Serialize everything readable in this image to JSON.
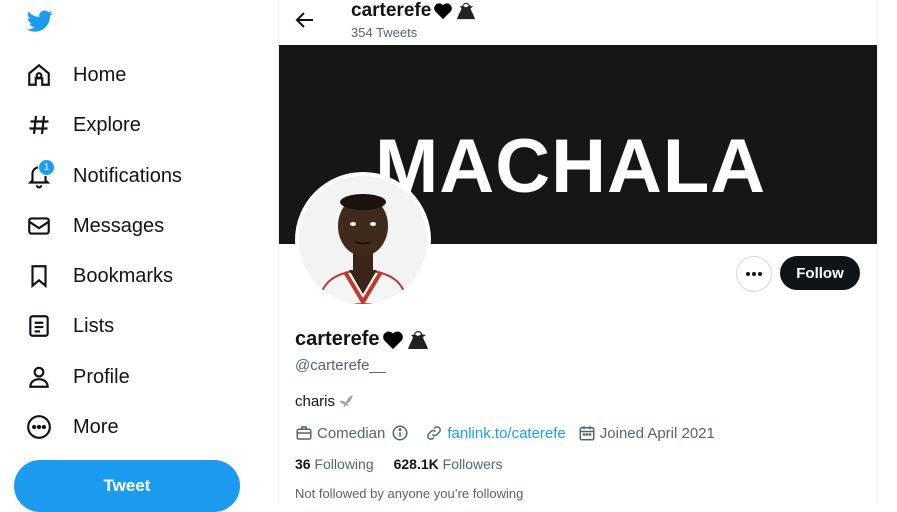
{
  "sidebar": {
    "nav": [
      {
        "label": "Home",
        "icon": "home-icon"
      },
      {
        "label": "Explore",
        "icon": "hashtag-icon"
      },
      {
        "label": "Notifications",
        "icon": "bell-icon",
        "badge": "1"
      },
      {
        "label": "Messages",
        "icon": "envelope-icon"
      },
      {
        "label": "Bookmarks",
        "icon": "bookmark-icon"
      },
      {
        "label": "Lists",
        "icon": "list-icon"
      },
      {
        "label": "Profile",
        "icon": "person-icon"
      },
      {
        "label": "More",
        "icon": "more-circle-icon"
      }
    ],
    "tweet_label": "Tweet"
  },
  "header": {
    "name": "carterefe",
    "tweet_count": "354 Tweets"
  },
  "banner": {
    "text": "MACHALA"
  },
  "profile": {
    "name": "carterefe",
    "handle": "@carterefe__",
    "bio": "charis",
    "category": "Comedian",
    "link": "fanlink.to/caterefe",
    "joined": "Joined April 2021",
    "following_count": "36",
    "following_label": "Following",
    "followers_count": "628.1K",
    "followers_label": "Followers",
    "not_followed": "Not followed by anyone you’re following",
    "follow_label": "Follow"
  },
  "colors": {
    "accent": "#1d9bf0",
    "text": "#0f1419",
    "muted": "#536471",
    "banner": "#161616"
  }
}
